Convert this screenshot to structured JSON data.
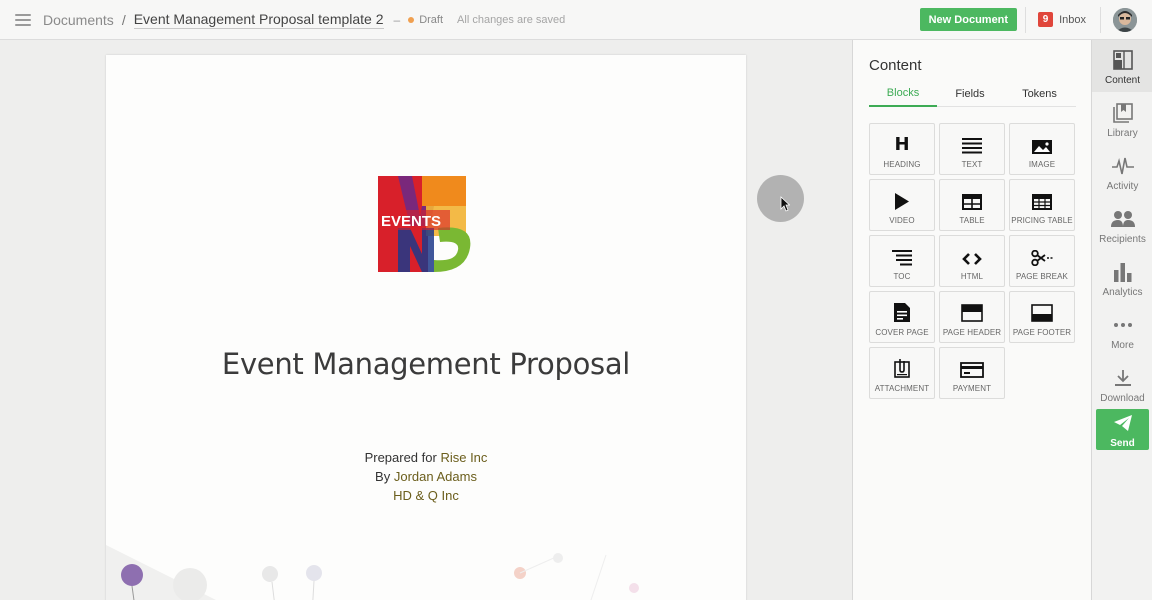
{
  "topbar": {
    "breadcrumb_root": "Documents",
    "separator": "/",
    "doc_name": "Event Management Proposal template 2",
    "dash": "–",
    "status": "Draft",
    "save_state": "All changes are saved",
    "new_document": "New Document",
    "inbox_count": "9",
    "inbox_label": "Inbox"
  },
  "document": {
    "logo_text": "EVENTS",
    "title": "Event Management Proposal",
    "prepared_for_label": "Prepared for",
    "prepared_for": "Rise Inc",
    "by_label": "By",
    "author": "Jordan Adams",
    "company": "HD & Q Inc"
  },
  "panel": {
    "title": "Content",
    "tabs": [
      {
        "label": "Blocks"
      },
      {
        "label": "Fields"
      },
      {
        "label": "Tokens"
      }
    ],
    "active_tab": "Blocks",
    "blocks": [
      {
        "label": "HEADING",
        "icon": "heading-icon"
      },
      {
        "label": "TEXT",
        "icon": "text-icon"
      },
      {
        "label": "IMAGE",
        "icon": "image-icon"
      },
      {
        "label": "VIDEO",
        "icon": "video-icon"
      },
      {
        "label": "TABLE",
        "icon": "table-icon"
      },
      {
        "label": "PRICING TABLE",
        "icon": "pricing-table-icon"
      },
      {
        "label": "TOC",
        "icon": "toc-icon"
      },
      {
        "label": "HTML",
        "icon": "html-icon"
      },
      {
        "label": "PAGE BREAK",
        "icon": "scissors-icon"
      },
      {
        "label": "COVER PAGE",
        "icon": "cover-page-icon"
      },
      {
        "label": "PAGE HEADER",
        "icon": "page-header-icon"
      },
      {
        "label": "PAGE FOOTER",
        "icon": "page-footer-icon"
      },
      {
        "label": "ATTACHMENT",
        "icon": "attachment-icon"
      },
      {
        "label": "PAYMENT",
        "icon": "payment-icon"
      }
    ]
  },
  "nav": {
    "items": [
      {
        "label": "Content",
        "icon": "content-icon"
      },
      {
        "label": "Library",
        "icon": "library-icon"
      },
      {
        "label": "Activity",
        "icon": "activity-icon"
      },
      {
        "label": "Recipients",
        "icon": "recipients-icon"
      },
      {
        "label": "Analytics",
        "icon": "analytics-icon"
      },
      {
        "label": "More",
        "icon": "more-icon"
      },
      {
        "label": "Download",
        "icon": "download-icon"
      }
    ],
    "active": "Content",
    "send": "Send"
  },
  "colors": {
    "accent_green": "#4cb860",
    "tab_green": "#3dab55",
    "badge_red": "#e0463b",
    "draft_orange": "#f0a050"
  }
}
